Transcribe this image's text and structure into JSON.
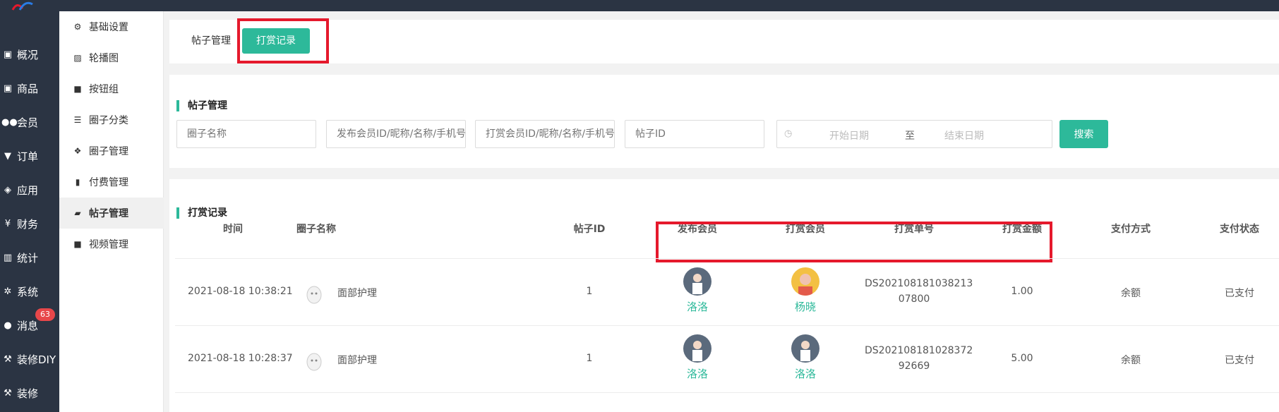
{
  "sidebar": {
    "items": [
      {
        "label": "概况",
        "icon": "dashboard-icon"
      },
      {
        "label": "商品",
        "icon": "goods-icon"
      },
      {
        "label": "会员",
        "icon": "users-icon"
      },
      {
        "label": "订单",
        "icon": "cart-icon"
      },
      {
        "label": "应用",
        "icon": "apps-icon"
      },
      {
        "label": "财务",
        "icon": "yen-icon"
      },
      {
        "label": "统计",
        "icon": "stats-icon"
      },
      {
        "label": "系统",
        "icon": "gears-icon"
      },
      {
        "label": "消息",
        "icon": "chat-icon"
      },
      {
        "label": "装修DIY",
        "icon": "hammer-icon"
      },
      {
        "label": "装修",
        "icon": "hammer-icon"
      }
    ],
    "message_badge": "63"
  },
  "subnav": {
    "items": [
      {
        "label": "基础设置",
        "icon": "settings-icon"
      },
      {
        "label": "轮播图",
        "icon": "image-icon"
      },
      {
        "label": "按钮组",
        "icon": "square-icon"
      },
      {
        "label": "圈子分类",
        "icon": "list-icon"
      },
      {
        "label": "圈子管理",
        "icon": "cubes-icon"
      },
      {
        "label": "付费管理",
        "icon": "bookmark-icon"
      },
      {
        "label": "帖子管理",
        "icon": "folder-open-icon"
      },
      {
        "label": "视频管理",
        "icon": "video-icon"
      }
    ],
    "active_index": 6
  },
  "tabs": {
    "posts": "帖子管理",
    "rewards": "打赏记录"
  },
  "filter": {
    "title": "帖子管理",
    "circle_placeholder": "圈子名称",
    "poster_placeholder": "发布会员ID/昵称/名称/手机号",
    "rewarder_placeholder": "打赏会员ID/昵称/名称/手机号",
    "post_id_placeholder": "帖子ID",
    "start_date": "开始日期",
    "date_sep": "至",
    "end_date": "结束日期",
    "search_label": "搜索"
  },
  "records": {
    "title": "打赏记录",
    "columns": [
      "时间",
      "圈子名称",
      "帖子ID",
      "发布会员",
      "打赏会员",
      "打赏单号",
      "打赏金额",
      "支付方式",
      "支付状态"
    ],
    "rows": [
      {
        "time": "2021-08-18 10:38:21",
        "circle": "面部护理",
        "post_id": "1",
        "poster": "洛洛",
        "rewarder": "杨晓",
        "order_no_1": "DS202108181038213",
        "order_no_2": "07800",
        "amount": "1.00",
        "pay_method": "余额",
        "pay_status": "已支付"
      },
      {
        "time": "2021-08-18 10:28:37",
        "circle": "面部护理",
        "post_id": "1",
        "poster": "洛洛",
        "rewarder": "洛洛",
        "order_no_1": "DS202108181028372",
        "order_no_2": "92669",
        "amount": "5.00",
        "pay_method": "余额",
        "pay_status": "已支付"
      }
    ]
  },
  "colors": {
    "accent": "#2db99a",
    "sidebar_bg": "#2b3443",
    "highlight_box": "#e5192c",
    "badge": "#e8474a"
  }
}
